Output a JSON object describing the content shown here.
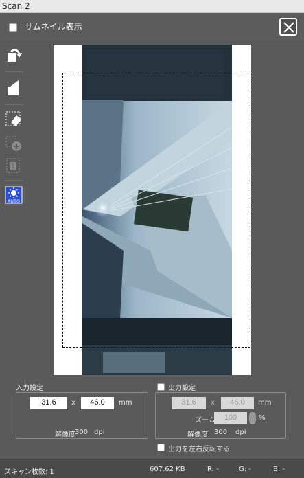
{
  "window": {
    "title": "Scan 2"
  },
  "topbar": {
    "thumbnail_label": "サムネイル表示"
  },
  "input_settings": {
    "label": "入力設定",
    "width": "31.6",
    "x": "x",
    "height": "46.0",
    "unit": "mm",
    "resolution_label": "解像度",
    "resolution": "300",
    "resolution_unit": "dpi"
  },
  "output_settings": {
    "label": "出力設定",
    "width": "31.6",
    "x": "x",
    "height": "46.0",
    "unit": "mm",
    "zoom_label": "ズーム",
    "zoom": "100",
    "zoom_unit": "%",
    "resolution_label": "解像度",
    "resolution": "300",
    "resolution_unit": "dpi",
    "flip_label": "出力を左右反転する"
  },
  "status": {
    "scan_count": "スキャン枚数: 1",
    "size": "607.62 KB",
    "r": "R:   -",
    "g": "G:   -",
    "b": "B:   -"
  },
  "toolbar": {
    "auto_label": "AUTO",
    "frame_number": "1"
  },
  "colors": {
    "background": "#5a5a5a",
    "accent_auto": "#2c4fd6"
  }
}
